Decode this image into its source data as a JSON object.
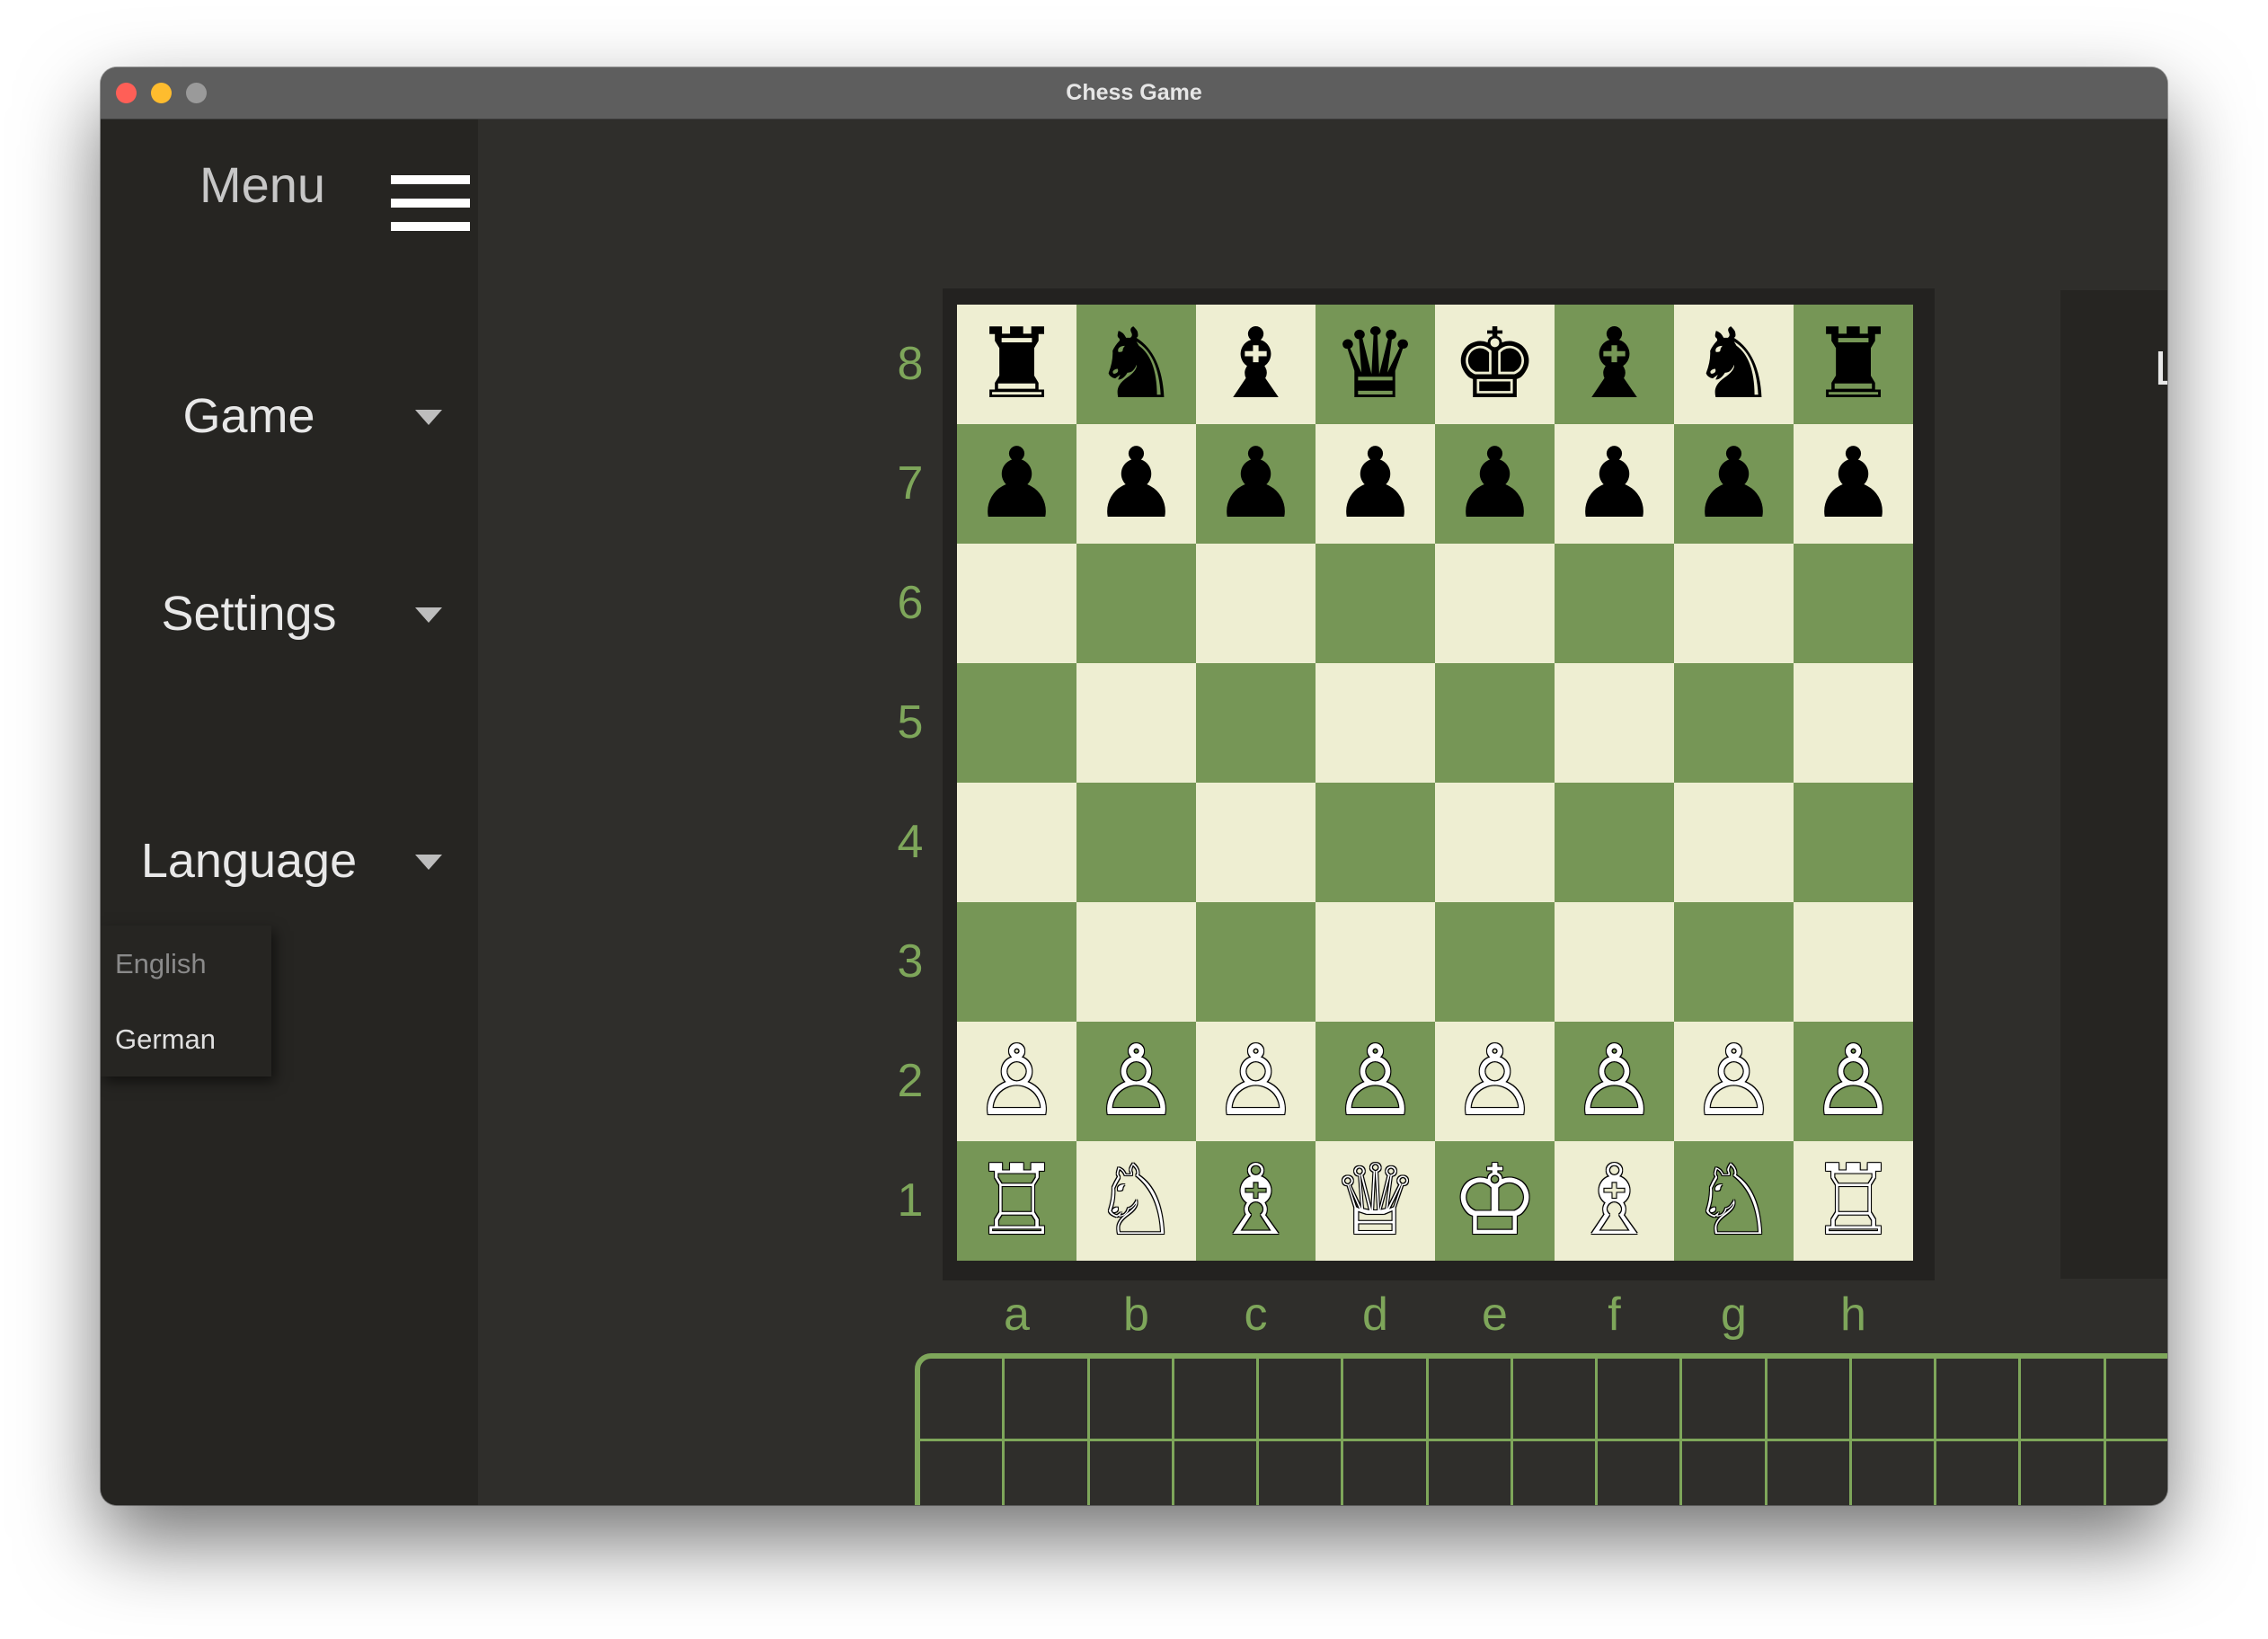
{
  "window": {
    "title": "Chess Game"
  },
  "sidebar": {
    "menu_label": "Menu",
    "items": [
      {
        "label": "Game"
      },
      {
        "label": "Settings"
      },
      {
        "label": "Language"
      }
    ],
    "language_options": [
      {
        "label": "English",
        "color": "#8a8a8a"
      },
      {
        "label": "German",
        "color": "#e0e0e0"
      }
    ]
  },
  "board": {
    "ranks": [
      "8",
      "7",
      "6",
      "5",
      "4",
      "3",
      "2",
      "1"
    ],
    "files": [
      "a",
      "b",
      "c",
      "d",
      "e",
      "f",
      "g",
      "h"
    ],
    "light_color": "#eeeed2",
    "dark_color": "#769656",
    "position": [
      [
        "r",
        "n",
        "b",
        "q",
        "k",
        "b",
        "n",
        "r"
      ],
      [
        "p",
        "p",
        "p",
        "p",
        "p",
        "p",
        "p",
        "p"
      ],
      [
        "",
        "",
        "",
        "",
        "",
        "",
        "",
        ""
      ],
      [
        "",
        "",
        "",
        "",
        "",
        "",
        "",
        ""
      ],
      [
        "",
        "",
        "",
        "",
        "",
        "",
        "",
        ""
      ],
      [
        "",
        "",
        "",
        "",
        "",
        "",
        "",
        ""
      ],
      [
        "P",
        "P",
        "P",
        "P",
        "P",
        "P",
        "P",
        "P"
      ],
      [
        "R",
        "N",
        "B",
        "Q",
        "K",
        "B",
        "N",
        "R"
      ]
    ]
  },
  "moves_panel": {
    "title": "Last moves:"
  },
  "captured_tray": {
    "columns": 16,
    "rows": 2
  }
}
